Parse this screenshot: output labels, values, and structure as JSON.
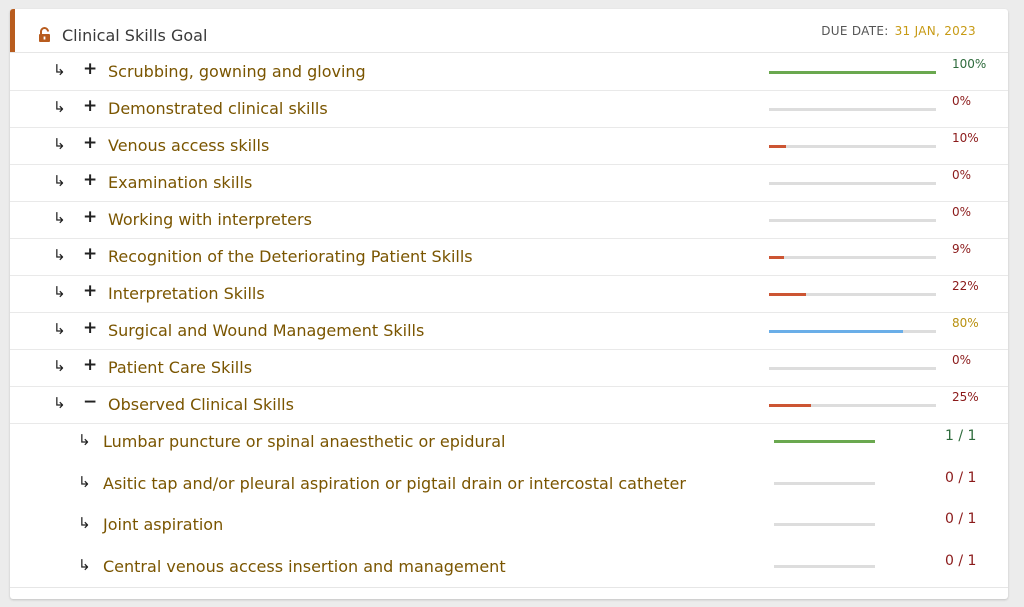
{
  "goal": {
    "title": "Clinical Skills Goal",
    "icon": "unlock-icon",
    "accent_color": "#b85c1e",
    "due_label": "DUE DATE:",
    "due_value": "31 JAN, 2023"
  },
  "skills": [
    {
      "label": "Scrubbing, gowning and gloving",
      "toggle": "+",
      "percent_text": "100%",
      "progress": 100,
      "bar_color": "#6aa84f",
      "text_color": "#2e6b3c"
    },
    {
      "label": "Demonstrated clinical skills",
      "toggle": "+",
      "percent_text": "0%",
      "progress": 0,
      "bar_color": "#cc5533",
      "text_color": "#8b1a1a"
    },
    {
      "label": "Venous access skills",
      "toggle": "+",
      "percent_text": "10%",
      "progress": 10,
      "bar_color": "#cc5533",
      "text_color": "#8b1a1a"
    },
    {
      "label": "Examination skills",
      "toggle": "+",
      "percent_text": "0%",
      "progress": 0,
      "bar_color": "#cc5533",
      "text_color": "#8b1a1a"
    },
    {
      "label": "Working with interpreters",
      "toggle": "+",
      "percent_text": "0%",
      "progress": 0,
      "bar_color": "#cc5533",
      "text_color": "#8b1a1a"
    },
    {
      "label": "Recognition of the Deteriorating Patient Skills",
      "toggle": "+",
      "percent_text": "9%",
      "progress": 9,
      "bar_color": "#cc5533",
      "text_color": "#8b1a1a"
    },
    {
      "label": "Interpretation Skills",
      "toggle": "+",
      "percent_text": "22%",
      "progress": 22,
      "bar_color": "#cc5533",
      "text_color": "#8b1a1a"
    },
    {
      "label": "Surgical and Wound Management Skills",
      "toggle": "+",
      "percent_text": "80%",
      "progress": 80,
      "bar_color": "#6aaee8",
      "text_color": "#b8900f"
    },
    {
      "label": "Patient Care Skills",
      "toggle": "+",
      "percent_text": "0%",
      "progress": 0,
      "bar_color": "#cc5533",
      "text_color": "#8b1a1a"
    },
    {
      "label": "Observed Clinical Skills",
      "toggle": "−",
      "percent_text": "25%",
      "progress": 25,
      "bar_color": "#cc5533",
      "text_color": "#8b1a1a"
    }
  ],
  "sub_skills": [
    {
      "label": "Lumbar puncture or spinal anaesthetic or epidural",
      "count_text": "1 / 1",
      "progress": 100,
      "bar_color": "#6aa84f",
      "text_color": "#2e6b3c"
    },
    {
      "label": "Asitic tap and/or pleural aspiration or pigtail drain or intercostal catheter",
      "count_text": "0 / 1",
      "progress": 0,
      "bar_color": "#cc5533",
      "text_color": "#8b1a1a"
    },
    {
      "label": "Joint aspiration",
      "count_text": "0 / 1",
      "progress": 0,
      "bar_color": "#cc5533",
      "text_color": "#8b1a1a"
    },
    {
      "label": "Central venous access insertion and management",
      "count_text": "0 / 1",
      "progress": 0,
      "bar_color": "#cc5533",
      "text_color": "#8b1a1a"
    }
  ],
  "icons": {
    "row_arrow": "↳"
  }
}
